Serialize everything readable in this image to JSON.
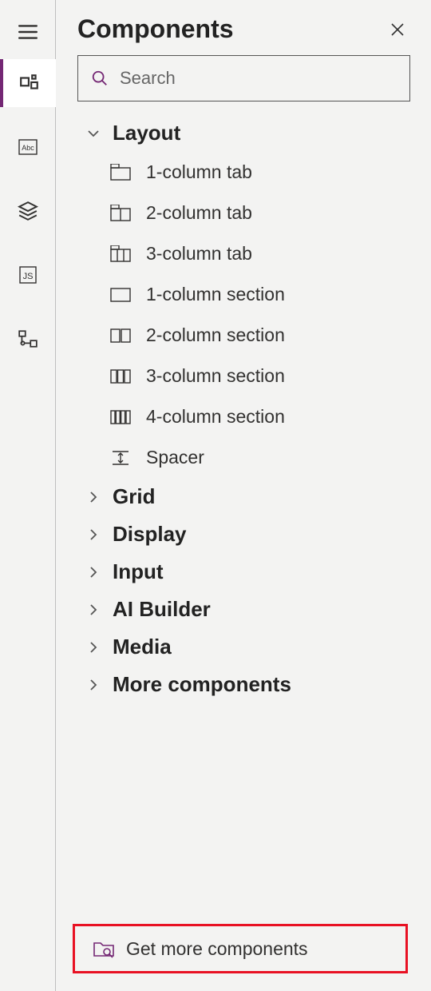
{
  "panel": {
    "title": "Components",
    "search_placeholder": "Search",
    "footer_label": "Get more components"
  },
  "categories": {
    "layout": {
      "label": "Layout",
      "expanded": true
    },
    "grid": {
      "label": "Grid",
      "expanded": false
    },
    "display": {
      "label": "Display",
      "expanded": false
    },
    "input": {
      "label": "Input",
      "expanded": false
    },
    "ai": {
      "label": "AI Builder",
      "expanded": false
    },
    "media": {
      "label": "Media",
      "expanded": false
    },
    "more": {
      "label": "More components",
      "expanded": false
    }
  },
  "layout_items": [
    {
      "label": "1-column tab"
    },
    {
      "label": "2-column tab"
    },
    {
      "label": "3-column tab"
    },
    {
      "label": "1-column section"
    },
    {
      "label": "2-column section"
    },
    {
      "label": "3-column section"
    },
    {
      "label": "4-column section"
    },
    {
      "label": "Spacer"
    }
  ]
}
